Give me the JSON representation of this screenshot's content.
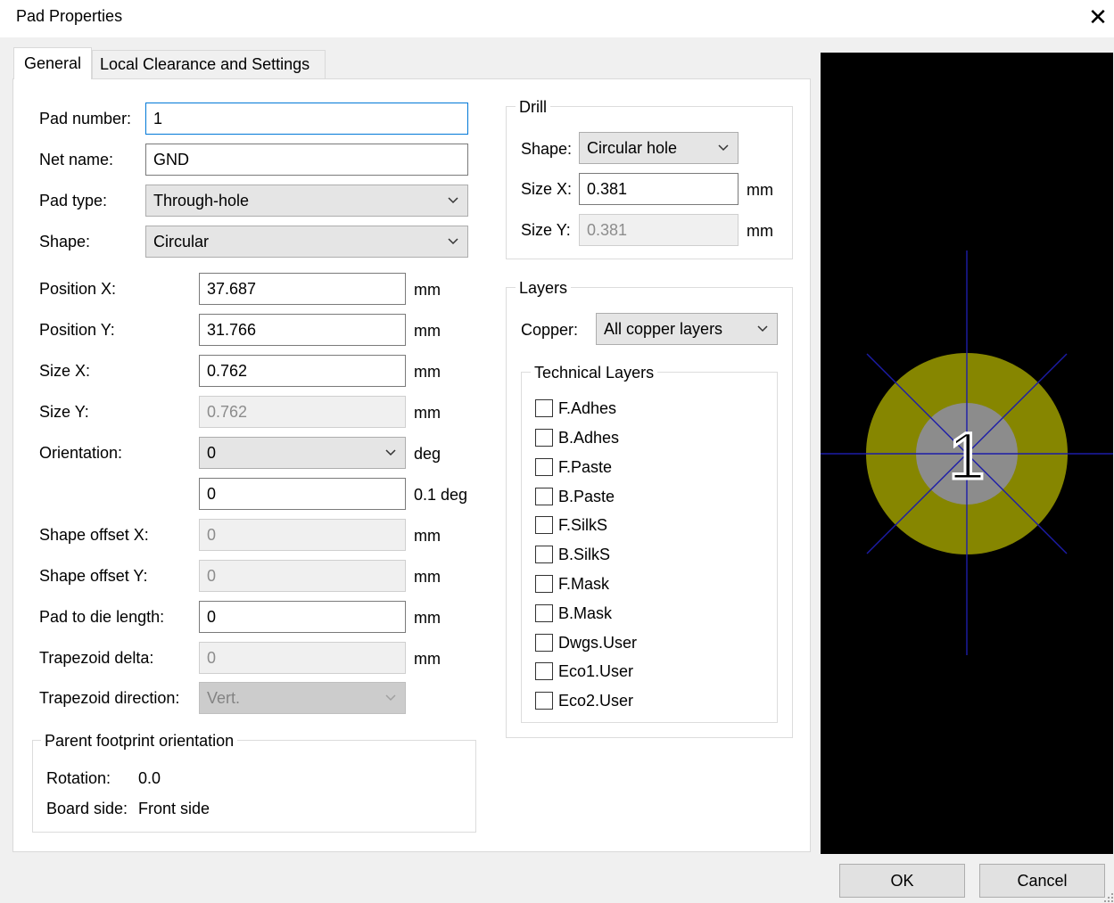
{
  "window": {
    "title": "Pad Properties",
    "close_glyph": "✕"
  },
  "tabs": [
    {
      "label": "General",
      "active": true
    },
    {
      "label": "Local Clearance and Settings",
      "active": false
    }
  ],
  "general": {
    "pad_number": {
      "label": "Pad number:",
      "value": "1"
    },
    "net_name": {
      "label": "Net name:",
      "value": "GND"
    },
    "pad_type": {
      "label": "Pad type:",
      "value": "Through-hole"
    },
    "shape": {
      "label": "Shape:",
      "value": "Circular"
    },
    "position_x": {
      "label": "Position X:",
      "value": "37.687",
      "unit": "mm"
    },
    "position_y": {
      "label": "Position Y:",
      "value": "31.766",
      "unit": "mm"
    },
    "size_x": {
      "label": "Size X:",
      "value": "0.762",
      "unit": "mm"
    },
    "size_y": {
      "label": "Size Y:",
      "value": "0.762",
      "unit": "mm"
    },
    "orientation": {
      "label": "Orientation:",
      "value": "0",
      "unit": "deg",
      "custom_value": "0",
      "custom_unit": "0.1 deg"
    },
    "shape_offset_x": {
      "label": "Shape offset X:",
      "value": "0",
      "unit": "mm"
    },
    "shape_offset_y": {
      "label": "Shape offset Y:",
      "value": "0",
      "unit": "mm"
    },
    "pad_to_die": {
      "label": "Pad to die length:",
      "value": "0",
      "unit": "mm"
    },
    "trapezoid_delta": {
      "label": "Trapezoid delta:",
      "value": "0",
      "unit": "mm"
    },
    "trapezoid_direction": {
      "label": "Trapezoid direction:",
      "value": "Vert."
    }
  },
  "parent": {
    "title": "Parent footprint orientation",
    "rotation_label": "Rotation:",
    "rotation_value": "0.0",
    "side_label": "Board side:",
    "side_value": "Front side"
  },
  "drill": {
    "title": "Drill",
    "shape_label": "Shape:",
    "shape_value": "Circular hole",
    "size_x_label": "Size X:",
    "size_x_value": "0.381",
    "size_y_label": "Size Y:",
    "size_y_value": "0.381",
    "unit": "mm"
  },
  "layers": {
    "title": "Layers",
    "copper_label": "Copper:",
    "copper_value": "All copper layers",
    "technical_title": "Technical Layers",
    "technical": [
      {
        "label": "F.Adhes",
        "checked": false
      },
      {
        "label": "B.Adhes",
        "checked": false
      },
      {
        "label": "F.Paste",
        "checked": false
      },
      {
        "label": "B.Paste",
        "checked": false
      },
      {
        "label": "F.SilkS",
        "checked": false
      },
      {
        "label": "B.SilkS",
        "checked": false
      },
      {
        "label": "F.Mask",
        "checked": false
      },
      {
        "label": "B.Mask",
        "checked": false
      },
      {
        "label": "Dwgs.User",
        "checked": false
      },
      {
        "label": "Eco1.User",
        "checked": false
      },
      {
        "label": "Eco2.User",
        "checked": false
      }
    ]
  },
  "preview": {
    "pad_label": "1",
    "colors": {
      "background": "#000000",
      "copper": "#868600",
      "hole": "#8c8c8c",
      "crosshair": "#1c1ca8"
    }
  },
  "buttons": {
    "ok": "OK",
    "cancel": "Cancel"
  }
}
